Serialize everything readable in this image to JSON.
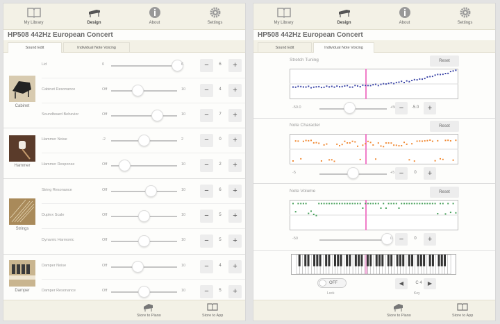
{
  "tabs": [
    {
      "label": "My Library",
      "icon": "book-icon"
    },
    {
      "label": "Design",
      "icon": "piano-design-icon"
    },
    {
      "label": "About",
      "icon": "info-icon"
    },
    {
      "label": "Settings",
      "icon": "gear-icon"
    }
  ],
  "selected_tab": "Design",
  "app_title": "HP508 442Hz European Concert",
  "segments": [
    "Sound Edit",
    "Individual Note Voicing"
  ],
  "bottom": {
    "store_piano": "Store to Piano",
    "store_app": "Store to App"
  },
  "sound_edit": {
    "groups": [
      {
        "name": "Cabinet",
        "icon": "grand-piano-photo-icon"
      },
      {
        "name": "Hammer",
        "icon": "hammer-photo-icon"
      },
      {
        "name": "Strings",
        "icon": "strings-photo-icon"
      },
      {
        "name": "Damper",
        "icon": "damper-photo-icon"
      }
    ],
    "rows": [
      {
        "label": "Lid",
        "min": "0",
        "max": "6",
        "value": "6",
        "fraction": 1.0
      },
      {
        "label": "Cabinet Resonance",
        "min": "Off",
        "max": "10",
        "value": "4",
        "fraction": 0.4
      },
      {
        "label": "Soundboard Behavior",
        "min": "Off",
        "max": "10",
        "value": "7",
        "fraction": 0.7
      },
      {
        "label": "Hammer Noise",
        "min": "-2",
        "max": "2",
        "value": "0",
        "fraction": 0.5
      },
      {
        "label": "Hammer Response",
        "min": "Off",
        "max": "10",
        "value": "2",
        "fraction": 0.2
      },
      {
        "label": "String Resonance",
        "min": "Off",
        "max": "10",
        "value": "6",
        "fraction": 0.6
      },
      {
        "label": "Duplex Scale",
        "min": "Off",
        "max": "10",
        "value": "5",
        "fraction": 0.5
      },
      {
        "label": "Dynamic Harmonic",
        "min": "Off",
        "max": "10",
        "value": "5",
        "fraction": 0.5
      },
      {
        "label": "Damper Noise",
        "min": "Off",
        "max": "10",
        "value": "4",
        "fraction": 0.4
      },
      {
        "label": "Damper Resonance",
        "min": "Off",
        "max": "10",
        "value": "5",
        "fraction": 0.5
      }
    ]
  },
  "note_voicing": {
    "reset_label": "Reset",
    "sections": [
      {
        "title": "Stretch Tuning",
        "min": "-50.0",
        "max": "+50.0",
        "value": "-5.0",
        "fraction": 0.45,
        "color": "#3d47a8"
      },
      {
        "title": "Note Character",
        "min": "-5",
        "max": "+5",
        "value": "0",
        "fraction": 0.5,
        "color": "#f08a35"
      },
      {
        "title": "Note Volume",
        "min": "-50",
        "max": "0",
        "value": "0",
        "fraction": 1.0,
        "color": "#46a05a"
      }
    ],
    "lock_label": "Lock",
    "toggle_label": "OFF",
    "key_label": "Key",
    "key_value": "C 4",
    "marker_color": "#f07dc8"
  }
}
